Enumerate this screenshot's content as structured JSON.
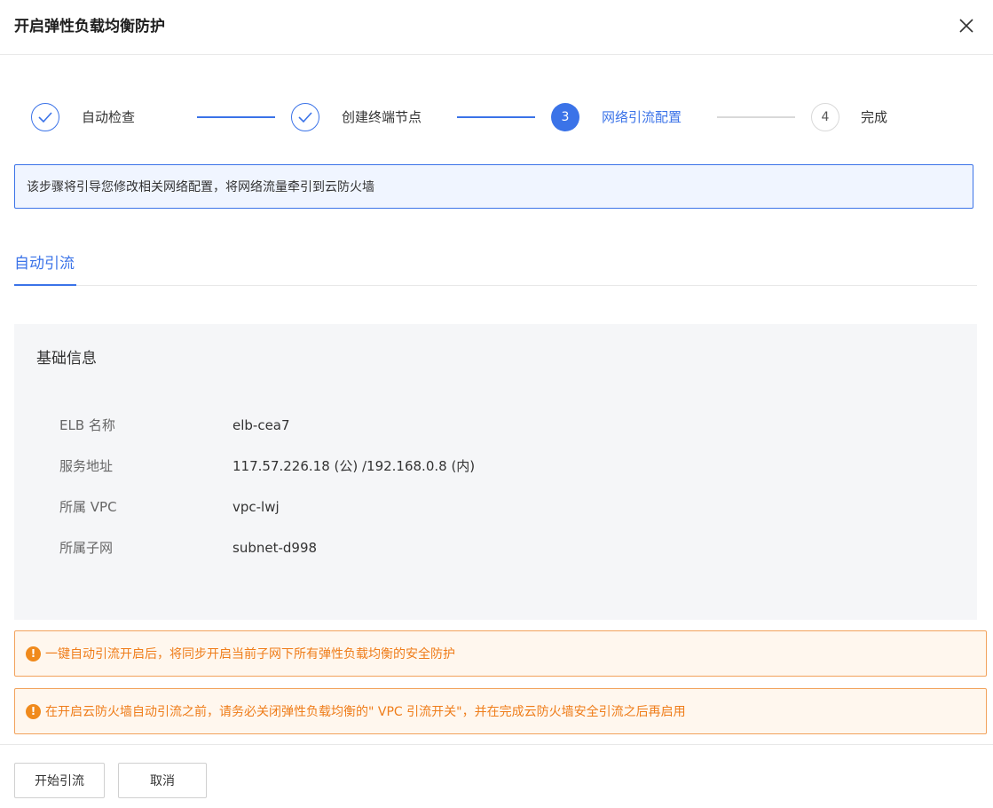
{
  "dialog": {
    "title": "开启弹性负载均衡防护"
  },
  "steps": [
    {
      "label": "自动检查",
      "number": "1",
      "state": "done"
    },
    {
      "label": "创建终端节点",
      "number": "2",
      "state": "done"
    },
    {
      "label": "网络引流配置",
      "number": "3",
      "state": "active"
    },
    {
      "label": "完成",
      "number": "4",
      "state": "pending"
    }
  ],
  "info_banner": {
    "text": "该步骤将引导您修改相关网络配置，将网络流量牵引到云防火墙"
  },
  "tabs": [
    {
      "label": "自动引流",
      "active": true
    }
  ],
  "basic_info": {
    "title": "基础信息",
    "rows": [
      {
        "key": "ELB 名称",
        "value": "elb-cea7"
      },
      {
        "key": "服务地址",
        "value": "117.57.226.18 (公) /192.168.0.8 (内)"
      },
      {
        "key": "所属 VPC",
        "value": "vpc-lwj"
      },
      {
        "key": "所属子网",
        "value": "subnet-d998"
      }
    ]
  },
  "warnings": [
    {
      "icon": "!",
      "text": "一键自动引流开启后，将同步开启当前子网下所有弹性负载均衡的安全防护"
    },
    {
      "icon": "!",
      "text": "在开启云防火墙自动引流之前，请务必关闭弹性负载均衡的\" VPC 引流开关\"，并在完成云防火墙安全引流之后再启用"
    }
  ],
  "footer": {
    "start_label": "开始引流",
    "cancel_label": "取消"
  },
  "colors": {
    "primary": "#3b73e8",
    "warning": "#ef7d1a",
    "warning_bg": "#fff7ee",
    "info_bg": "#f0f5ff",
    "panel_bg": "#f5f6f8"
  }
}
